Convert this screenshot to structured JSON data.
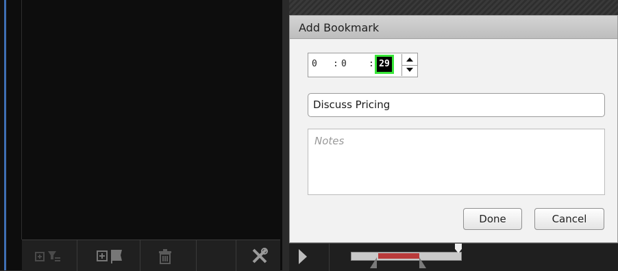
{
  "dialog": {
    "title": "Add Bookmark",
    "time": {
      "hours": "0",
      "minutes": "0",
      "seconds": "29",
      "separator": ":"
    },
    "name_value": "Discuss Pricing",
    "notes_placeholder": "Notes",
    "done_label": "Done",
    "cancel_label": "Cancel"
  },
  "toolbar": {
    "icons": [
      "add-filter-icon",
      "add-bookmark-icon",
      "delete-icon",
      "tools-icon"
    ]
  },
  "timeline": {
    "play_icon": "play-icon"
  },
  "colors": {
    "accent_stripe": "#3f6fb4",
    "focus_outline": "#39e639",
    "range_fill": "#b83a3a"
  }
}
